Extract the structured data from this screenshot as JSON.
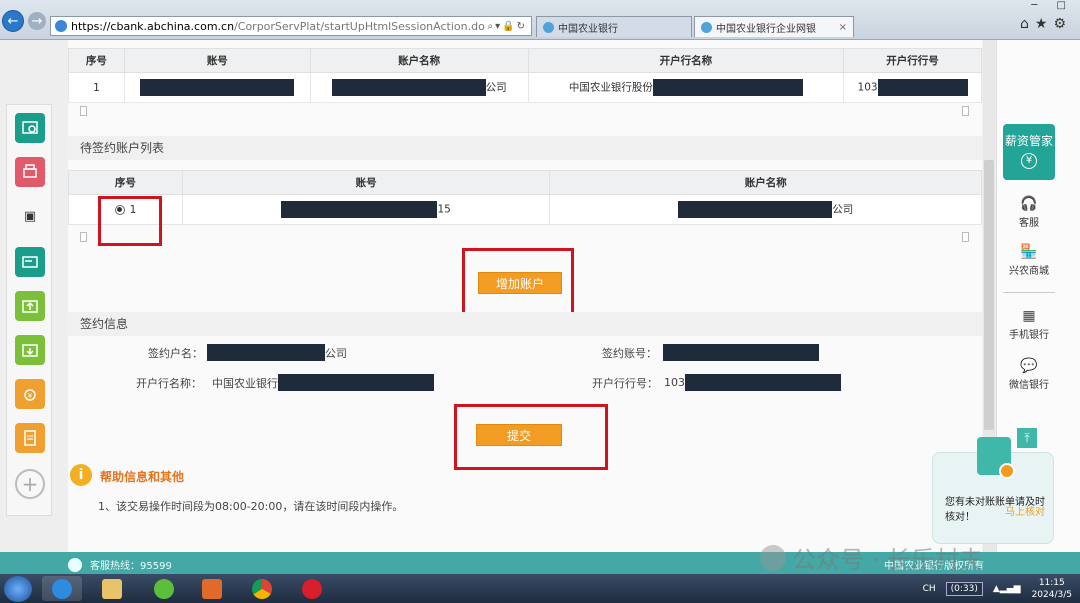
{
  "browser": {
    "url_host": "https://cbank.abchina.com.cn",
    "url_path": "/CorporServPlat/startUpHtmlSessionAction.do",
    "tabs": [
      {
        "label": "中国农业银行"
      },
      {
        "label": "中国农业银行企业网银"
      }
    ]
  },
  "table1": {
    "headers": [
      "序号",
      "账号",
      "账户名称",
      "开户行名称",
      "开户行行号"
    ],
    "row": {
      "index": "1",
      "name_suffix": "公司",
      "bank_prefix": "中国农业银行股份",
      "bank_no_prefix": "103"
    }
  },
  "pending": {
    "title": "待签约账户列表",
    "headers": [
      "序号",
      "账号",
      "账户名称"
    ],
    "row": {
      "index": "1",
      "account_suffix": "15",
      "name_suffix": "公司"
    },
    "add_button": "增加账户"
  },
  "sign_info": {
    "title": "签约信息",
    "signer_name_label": "签约户名：",
    "signer_name_suffix": "公司",
    "sign_account_label": "签约账号：",
    "bank_name_label": "开户行名称：",
    "bank_name_prefix": "中国农业银行",
    "bank_no_label": "开户行行号：",
    "bank_no_prefix": "103",
    "submit_button": "提交"
  },
  "help": {
    "title": "帮助信息和其他",
    "item1": "1、该交易操作时间段为08:00-20:00，请在该时间段内操作。"
  },
  "right_panel": {
    "xinzi_label": "薪资管家",
    "xinzi_icon": "¥",
    "items": [
      {
        "label": "客服",
        "icon": "headset-icon"
      },
      {
        "label": "兴农商城",
        "icon": "shop-icon"
      },
      {
        "label": "手机银行",
        "icon": "qrcode-icon"
      },
      {
        "label": "微信银行",
        "icon": "wechat-icon"
      }
    ]
  },
  "notice": {
    "text": "您有未对账账单请及时核对！",
    "link": "马上核对"
  },
  "footer": {
    "hotline": "客服热线：95599",
    "copyright": "中国农业银行版权所有"
  },
  "watermark": "公众号 · 长乐村夫",
  "taskbar": {
    "lang": "CH",
    "timer": "(0:33)",
    "time": "11:15",
    "date": "2024/3/5"
  },
  "colors": {
    "accent_orange": "#f39c24",
    "teal": "#44a8a6",
    "highlight_red": "#d0141d"
  }
}
